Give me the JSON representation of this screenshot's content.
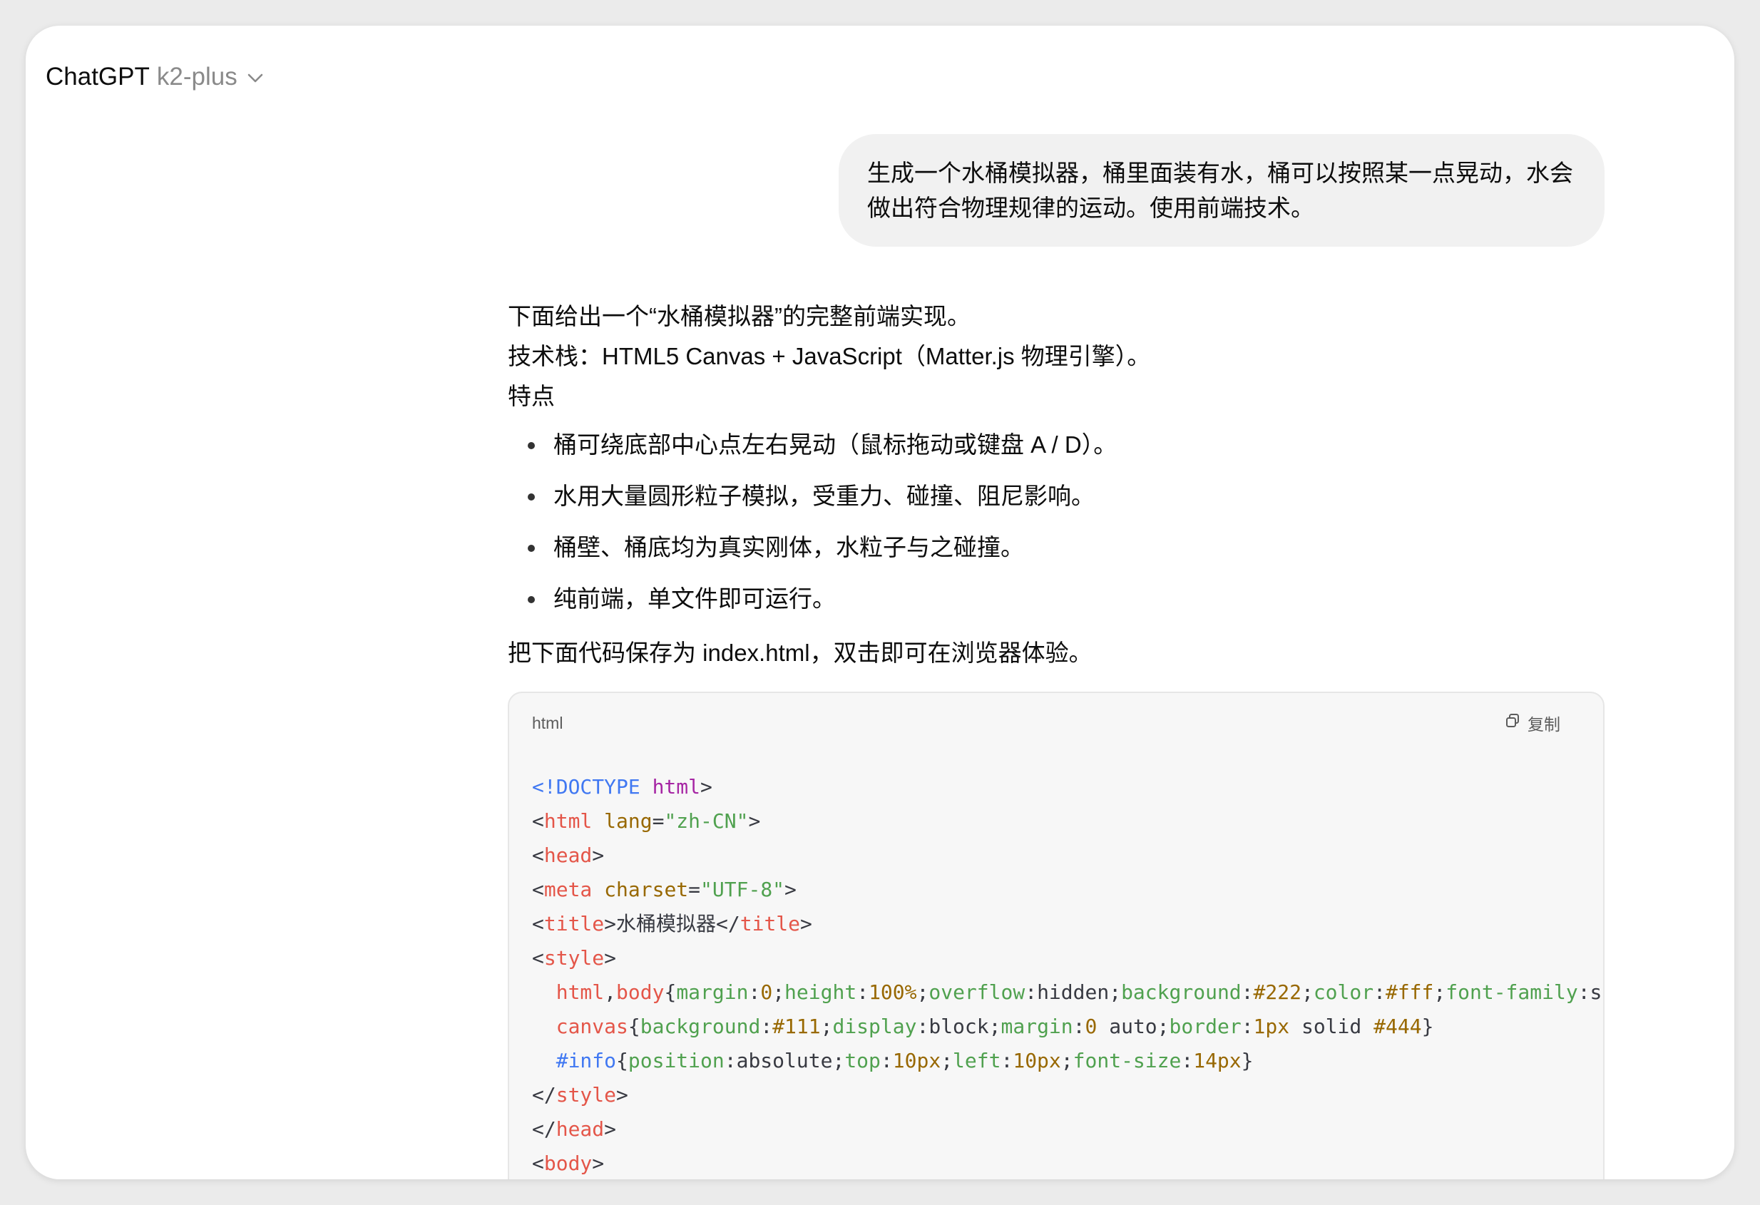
{
  "header": {
    "brand": "ChatGPT",
    "model": "k2-plus"
  },
  "user_message": "生成一个水桶模拟器，桶里面装有水，桶可以按照某一点晃动，水会做出符合物理规律的运动。使用前端技术。",
  "assistant": {
    "intro": "下面给出一个“水桶模拟器”的完整前端实现。",
    "tech_stack": "技术栈：HTML5 Canvas + JavaScript（Matter.js 物理引擎）。",
    "features_heading": "特点",
    "bullets": [
      "桶可绕底部中心点左右晃动（鼠标拖动或键盘 A / D）。",
      "水用大量圆形粒子模拟，受重力、碰撞、阻尼影响。",
      "桶壁、桶底均为真实刚体，水粒子与之碰撞。",
      "纯前端，单文件即可运行。"
    ],
    "save_instruction": "把下面代码保存为 index.html，双击即可在浏览器体验。"
  },
  "code_block": {
    "language": "html",
    "copy_label": "复制",
    "lines": [
      [
        [
          "doc",
          "<!DOCTYPE "
        ],
        [
          "kw",
          "html"
        ],
        [
          "pl",
          ">"
        ]
      ],
      [
        [
          "pl",
          "<"
        ],
        [
          "tag",
          "html"
        ],
        [
          "pl",
          " "
        ],
        [
          "attr",
          "lang"
        ],
        [
          "pl",
          "="
        ],
        [
          "str",
          "\"zh-CN\""
        ],
        [
          "pl",
          ">"
        ]
      ],
      [
        [
          "pl",
          "<"
        ],
        [
          "tag",
          "head"
        ],
        [
          "pl",
          ">"
        ]
      ],
      [
        [
          "pl",
          "<"
        ],
        [
          "tag",
          "meta"
        ],
        [
          "pl",
          " "
        ],
        [
          "attr",
          "charset"
        ],
        [
          "pl",
          "="
        ],
        [
          "str",
          "\"UTF-8\""
        ],
        [
          "pl",
          ">"
        ]
      ],
      [
        [
          "pl",
          "<"
        ],
        [
          "tag",
          "title"
        ],
        [
          "pl",
          ">水桶模拟器</"
        ],
        [
          "tag",
          "title"
        ],
        [
          "pl",
          ">"
        ]
      ],
      [
        [
          "pl",
          "<"
        ],
        [
          "tag",
          "style"
        ],
        [
          "pl",
          ">"
        ]
      ],
      [
        [
          "pl",
          "  "
        ],
        [
          "tag",
          "html"
        ],
        [
          "pl",
          ","
        ],
        [
          "tag",
          "body"
        ],
        [
          "pl",
          "{"
        ],
        [
          "prop",
          "margin"
        ],
        [
          "pl",
          ":"
        ],
        [
          "num",
          "0"
        ],
        [
          "pl",
          ";"
        ],
        [
          "prop",
          "height"
        ],
        [
          "pl",
          ":"
        ],
        [
          "num",
          "100%"
        ],
        [
          "pl",
          ";"
        ],
        [
          "prop",
          "overflow"
        ],
        [
          "pl",
          ":hidden;"
        ],
        [
          "prop",
          "background"
        ],
        [
          "pl",
          ":"
        ],
        [
          "num",
          "#222"
        ],
        [
          "pl",
          ";"
        ],
        [
          "prop",
          "color"
        ],
        [
          "pl",
          ":"
        ],
        [
          "num",
          "#fff"
        ],
        [
          "pl",
          ";"
        ],
        [
          "prop",
          "font-family"
        ],
        [
          "pl",
          ":s"
        ]
      ],
      [
        [
          "pl",
          "  "
        ],
        [
          "tag",
          "canvas"
        ],
        [
          "pl",
          "{"
        ],
        [
          "prop",
          "background"
        ],
        [
          "pl",
          ":"
        ],
        [
          "num",
          "#111"
        ],
        [
          "pl",
          ";"
        ],
        [
          "prop",
          "display"
        ],
        [
          "pl",
          ":block;"
        ],
        [
          "prop",
          "margin"
        ],
        [
          "pl",
          ":"
        ],
        [
          "num",
          "0"
        ],
        [
          "pl",
          " auto;"
        ],
        [
          "prop",
          "border"
        ],
        [
          "pl",
          ":"
        ],
        [
          "num",
          "1px"
        ],
        [
          "pl",
          " solid "
        ],
        [
          "num",
          "#444"
        ],
        [
          "pl",
          "}"
        ]
      ],
      [
        [
          "pl",
          "  "
        ],
        [
          "id",
          "#info"
        ],
        [
          "pl",
          "{"
        ],
        [
          "prop",
          "position"
        ],
        [
          "pl",
          ":absolute;"
        ],
        [
          "prop",
          "top"
        ],
        [
          "pl",
          ":"
        ],
        [
          "num",
          "10px"
        ],
        [
          "pl",
          ";"
        ],
        [
          "prop",
          "left"
        ],
        [
          "pl",
          ":"
        ],
        [
          "num",
          "10px"
        ],
        [
          "pl",
          ";"
        ],
        [
          "prop",
          "font-size"
        ],
        [
          "pl",
          ":"
        ],
        [
          "num",
          "14px"
        ],
        [
          "pl",
          "}"
        ]
      ],
      [
        [
          "pl",
          "</"
        ],
        [
          "tag",
          "style"
        ],
        [
          "pl",
          ">"
        ]
      ],
      [
        [
          "pl",
          "</"
        ],
        [
          "tag",
          "head"
        ],
        [
          "pl",
          ">"
        ]
      ],
      [
        [
          "pl",
          "<"
        ],
        [
          "tag",
          "body"
        ],
        [
          "pl",
          ">"
        ]
      ]
    ]
  }
}
